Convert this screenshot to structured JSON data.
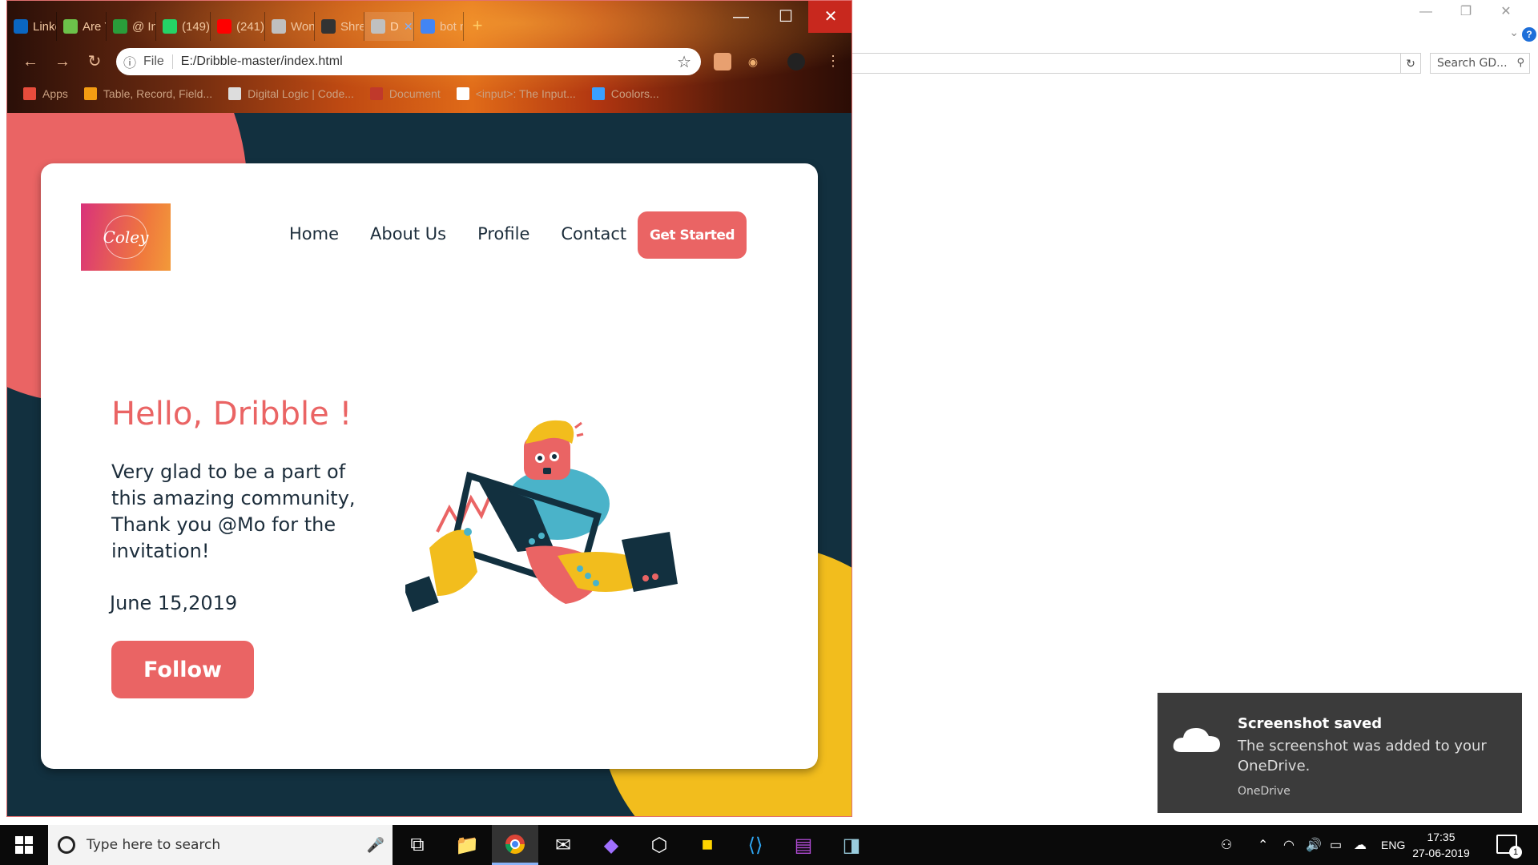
{
  "browser": {
    "tabs": [
      {
        "label": "Linke",
        "icon": "linkedin-icon",
        "color": "#0a66c2"
      },
      {
        "label": "Are Y",
        "icon": "app-icon",
        "color": "#6cc24a"
      },
      {
        "label": "@ Int",
        "icon": "chart-icon",
        "color": "#2a9d3a"
      },
      {
        "label": "(149)",
        "icon": "whatsapp-icon",
        "color": "#25d366"
      },
      {
        "label": "(241)",
        "icon": "youtube-icon",
        "color": "#ff0000"
      },
      {
        "label": "Won",
        "icon": "globe-icon",
        "color": "#c0c0c0"
      },
      {
        "label": "Shre",
        "icon": "github-icon",
        "color": "#333333"
      },
      {
        "label": "D",
        "icon": "globe-icon",
        "color": "#c0c0c0"
      },
      {
        "label": "bot n",
        "icon": "google-icon",
        "color": "#4285f4"
      }
    ],
    "new_tab": "+",
    "file_label": "File",
    "url": "E:/Dribble-master/index.html",
    "bookmarks": [
      {
        "label": "Apps",
        "icon": "apps-icon"
      },
      {
        "label": "Table, Record, Field...",
        "icon": "bookmark-icon"
      },
      {
        "label": "Digital Logic | Code...",
        "icon": "bookmark-icon"
      },
      {
        "label": "Document",
        "icon": "globe-icon"
      },
      {
        "label": "<input>: The Input...",
        "icon": "bookmark-icon"
      },
      {
        "label": "Coolors...",
        "icon": "bookmark-icon"
      }
    ]
  },
  "site": {
    "logo_text": "Coley",
    "nav": [
      "Home",
      "About Us",
      "Profile",
      "Contact"
    ],
    "cta": "Get Started",
    "greeting": "Hello, Dribble !",
    "message": "Very glad to be a part of this amazing community, Thank you @Mo for the invitation!",
    "date": "June 15,2019",
    "follow": "Follow"
  },
  "explorer": {
    "search_placeholder": "Search GD...",
    "help": "?"
  },
  "taskbar": {
    "search_placeholder": "Type here to search",
    "language": "ENG",
    "time": "17:35",
    "date": "27-06-2019",
    "notifications": "1"
  },
  "toast": {
    "title": "Screenshot saved",
    "body": "The screenshot was added to your OneDrive.",
    "source": "OneDrive"
  },
  "colors": {
    "coral": "#ea6464",
    "navy": "#12303f",
    "yellow": "#f2bd1d"
  }
}
